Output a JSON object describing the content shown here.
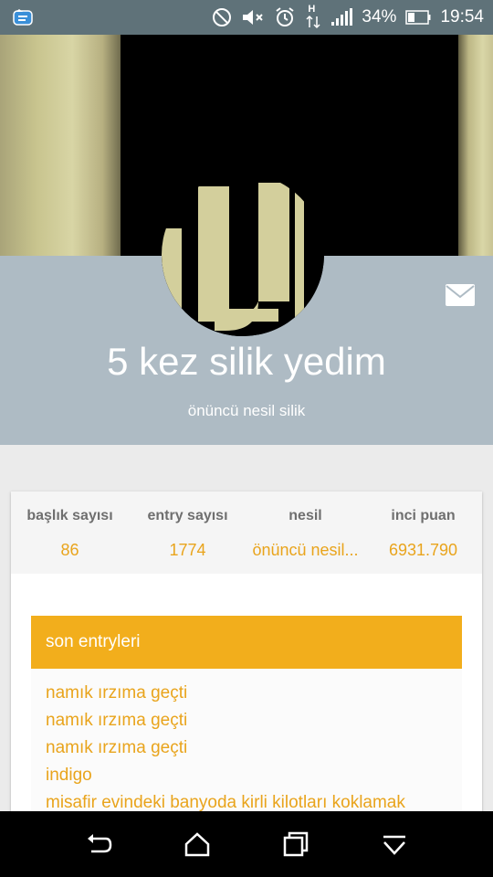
{
  "status_bar": {
    "battery": "34%",
    "time": "19:54",
    "network_letter": "H"
  },
  "profile": {
    "username": "5 kez silik yedim",
    "subtitle": "önüncü nesil silik",
    "avatar_letter": "LJ",
    "colors": {
      "band": "#aebbc4",
      "accent": "#f2ae1c",
      "link": "#e9a41c"
    }
  },
  "stats": [
    {
      "label": "başlık sayısı",
      "value": "86"
    },
    {
      "label": "entry sayısı",
      "value": "1774"
    },
    {
      "label": "nesil",
      "value": "önüncü nesil..."
    },
    {
      "label": "inci puan",
      "value": "6931.790"
    }
  ],
  "entries": {
    "header": "son entryleri",
    "items": [
      "namık ırzıma geçti",
      "namık ırzıma geçti",
      "namık ırzıma geçti",
      "indigo",
      "misafir evindeki banyoda kirli kilotları koklamak"
    ]
  },
  "icons": {
    "app": "app-notification-icon",
    "dnd": "do-not-disturb-icon",
    "mute": "volume-mute-icon",
    "alarm": "alarm-icon",
    "data": "data-arrows-icon",
    "signal": "signal-bars-icon",
    "battery": "battery-icon",
    "mail": "mail-icon",
    "back": "back-icon",
    "home": "home-icon",
    "recents": "recents-icon",
    "hide": "hide-keyboard-icon"
  }
}
